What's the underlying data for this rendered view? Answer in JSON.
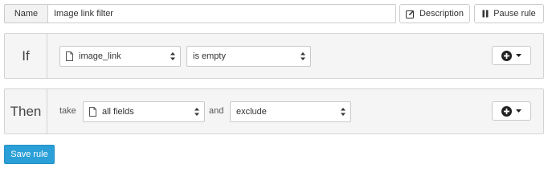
{
  "name_row": {
    "label": "Name",
    "value": "Image link filter"
  },
  "toolbar": {
    "description_label": "Description",
    "pause_label": "Pause rule"
  },
  "if_panel": {
    "label": "If",
    "field_select": {
      "value": "image_link",
      "icon": "document-icon"
    },
    "condition_select": {
      "value": "is empty"
    },
    "add_button_icon": "plus-circle-icon"
  },
  "then_panel": {
    "label": "Then",
    "take_text": "take",
    "fields_select": {
      "value": "all fields",
      "icon": "document-icon"
    },
    "and_text": "and",
    "action_select": {
      "value": "exclude"
    },
    "add_button_icon": "plus-circle-icon"
  },
  "save_label": "Save rule",
  "colors": {
    "accent": "#2a9fd8",
    "panel_bg": "#f5f5f5",
    "border": "#d4d4d4"
  }
}
